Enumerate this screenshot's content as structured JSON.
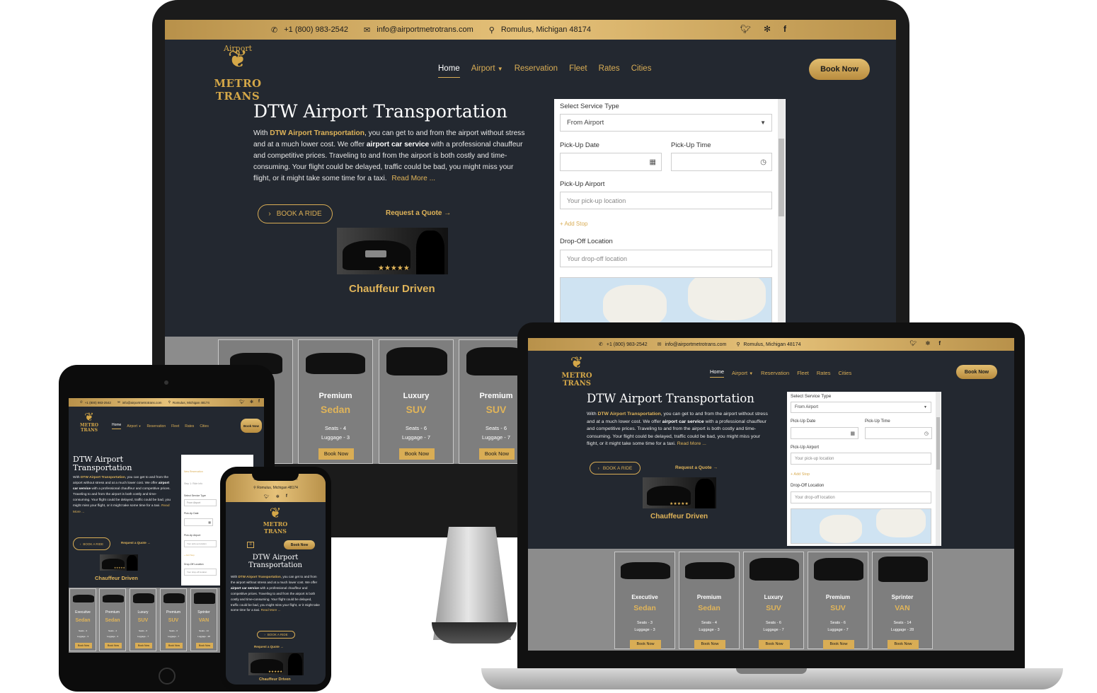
{
  "contact": {
    "phone": "+1 (800) 983-2542",
    "email": "info@airportmetrotrans.com",
    "address": "Romulus, Michigan 48174",
    "phone_icon": "phone-icon",
    "email_icon": "envelope-icon",
    "address_icon": "map-pin-icon"
  },
  "social": {
    "twitter": "twitter-icon",
    "yelp": "yelp-icon",
    "facebook": "facebook-icon"
  },
  "logo": {
    "line1": "Airport",
    "line2": "METRO TRANS"
  },
  "nav": {
    "home": "Home",
    "airport": "Airport",
    "reservation": "Reservation",
    "fleet": "Fleet",
    "rates": "Rates",
    "cities": "Cities"
  },
  "book_now": "Book Now",
  "hero": {
    "title": "DTW Airport Transportation",
    "p1_pre": "With ",
    "p1_link": "DTW Airport Transportation",
    "p1_mid": ", you can get to and from the airport without stress and at a much lower cost. We offer ",
    "p1_bold": "airport car service",
    "p1_post": " with a professional chauffeur and competitive prices. Traveling to and from the airport is both costly and time-consuming. Your flight could be delayed, traffic could be bad, you might miss your flight, or it might take some time for a taxi.",
    "read_more": "Read More ...",
    "book_a_ride": "BOOK A RIDE",
    "request_quote": "Request a Quote →",
    "chauffeur": "Chauffeur Driven",
    "stars": "★★★★★"
  },
  "form": {
    "service_type_label": "Select Service Type",
    "service_type_value": "From Airport",
    "pickup_date_label": "Pick-Up Date",
    "pickup_time_label": "Pick-Up Time",
    "pickup_airport_label": "Pick-Up Airport",
    "pickup_placeholder": "Your pick-up location",
    "add_stop": "+ Add Stop",
    "dropoff_label": "Drop-Off Location",
    "dropoff_placeholder": "Your drop-off location",
    "tablet_new_reservation": "New Reservation",
    "tablet_step": "Step 1: Ride Info"
  },
  "fleet": [
    {
      "name": "Executive",
      "type": "Sedan",
      "seats": "Seats - 3",
      "luggage": "Luggage - 3",
      "button": "Book Now"
    },
    {
      "name": "Premium",
      "type": "Sedan",
      "seats": "Seats - 4",
      "luggage": "Luggage - 3",
      "button": "Book Now"
    },
    {
      "name": "Luxury",
      "type": "SUV",
      "seats": "Seats - 6",
      "luggage": "Luggage - 7",
      "button": "Book Now"
    },
    {
      "name": "Premium",
      "type": "SUV",
      "seats": "Seats - 6",
      "luggage": "Luggage - 7",
      "button": "Book Now"
    },
    {
      "name": "Sprinter",
      "type": "VAN",
      "seats": "Seats - 14",
      "luggage": "Luggage - 28",
      "button": "Book Now"
    }
  ],
  "colors": {
    "accent": "#d9ad55",
    "background": "#232830",
    "topbar": "#e6c27a",
    "fleet_bg": "#8c8c8c"
  }
}
